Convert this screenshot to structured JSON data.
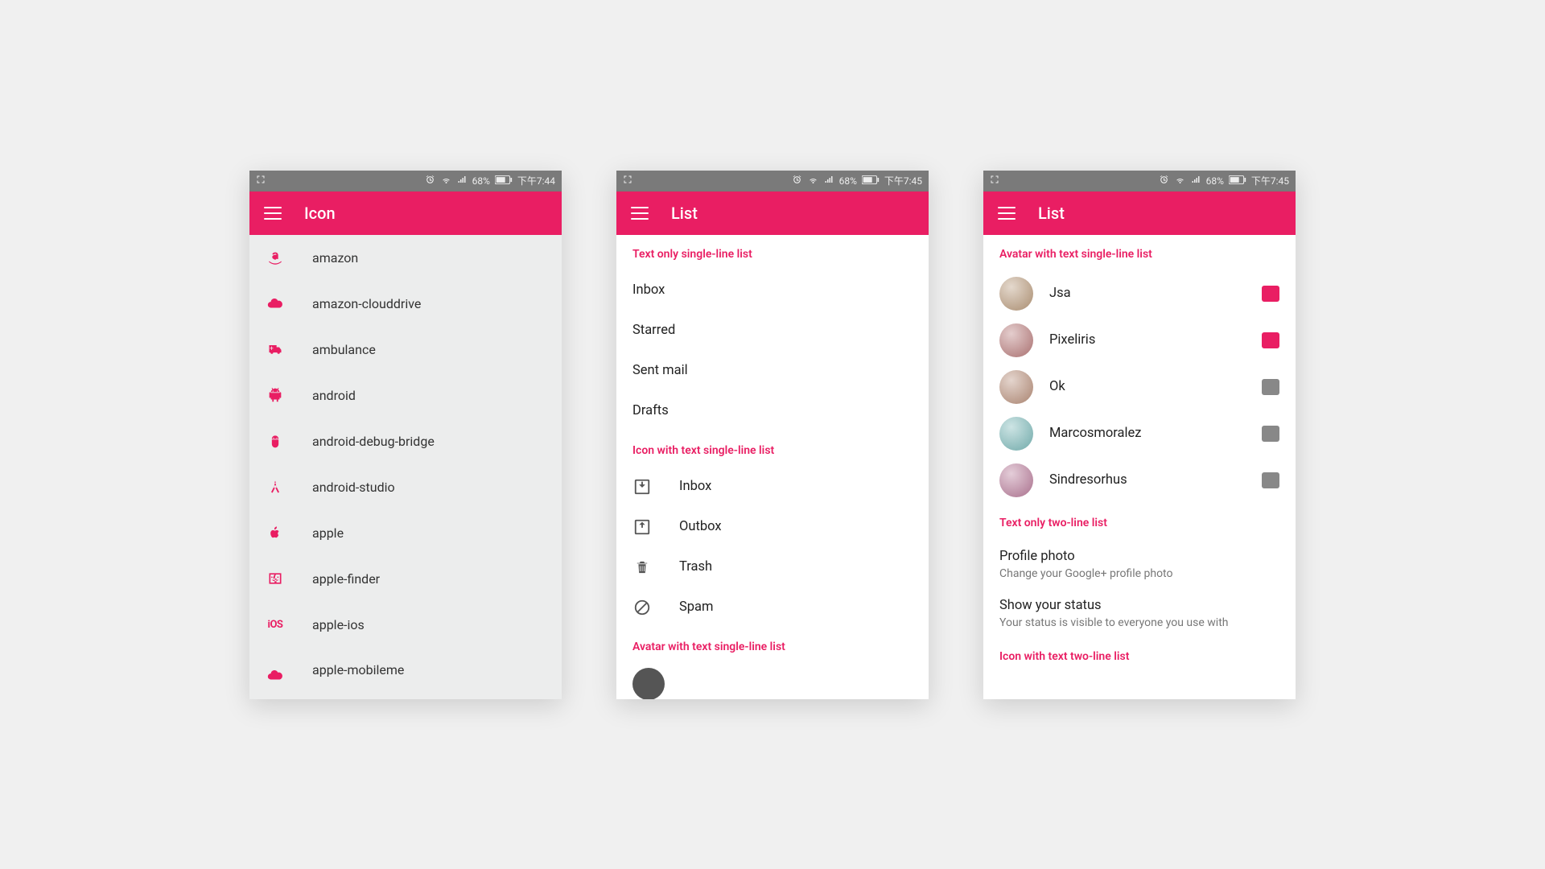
{
  "statusbar": {
    "battery": "68%",
    "time1": "下午7:44",
    "time2": "下午7:45"
  },
  "s1": {
    "title": "Icon",
    "items": [
      {
        "icon": "amazon",
        "label": "amazon"
      },
      {
        "icon": "cloud",
        "label": "amazon-clouddrive"
      },
      {
        "icon": "ambulance",
        "label": "ambulance"
      },
      {
        "icon": "android",
        "label": "android"
      },
      {
        "icon": "adb",
        "label": "android-debug-bridge"
      },
      {
        "icon": "android-studio",
        "label": "android-studio"
      },
      {
        "icon": "apple",
        "label": "apple"
      },
      {
        "icon": "finder",
        "label": "apple-finder"
      },
      {
        "icon": "ios",
        "label": "apple-ios"
      },
      {
        "icon": "mobileme",
        "label": "apple-mobileme"
      }
    ]
  },
  "s2": {
    "title": "List",
    "h1": "Text only single-line list",
    "textonly": [
      "Inbox",
      "Starred",
      "Sent mail",
      "Drafts"
    ],
    "h2": "Icon with text single-line list",
    "icontext": [
      {
        "icon": "inbox",
        "label": "Inbox"
      },
      {
        "icon": "outbox",
        "label": "Outbox"
      },
      {
        "icon": "trash",
        "label": "Trash"
      },
      {
        "icon": "spam",
        "label": "Spam"
      }
    ],
    "h3": "Avatar with text single-line list"
  },
  "s3": {
    "title": "List",
    "h1": "Avatar with text single-line list",
    "avatars": [
      {
        "name": "Jsa",
        "active": true,
        "hue": 30
      },
      {
        "name": "Pixeliris",
        "active": true,
        "hue": 0
      },
      {
        "name": "Ok",
        "active": false,
        "hue": 20
      },
      {
        "name": "Marcosmoralez",
        "active": false,
        "hue": 180
      },
      {
        "name": "Sindresorhus",
        "active": false,
        "hue": 330
      }
    ],
    "h2": "Text only two-line list",
    "twolines": [
      {
        "primary": "Profile photo",
        "secondary": "Change your Google+ profile photo"
      },
      {
        "primary": "Show your status",
        "secondary": "Your status is visible to everyone you use with"
      }
    ],
    "h3": "Icon with text two-line list"
  }
}
